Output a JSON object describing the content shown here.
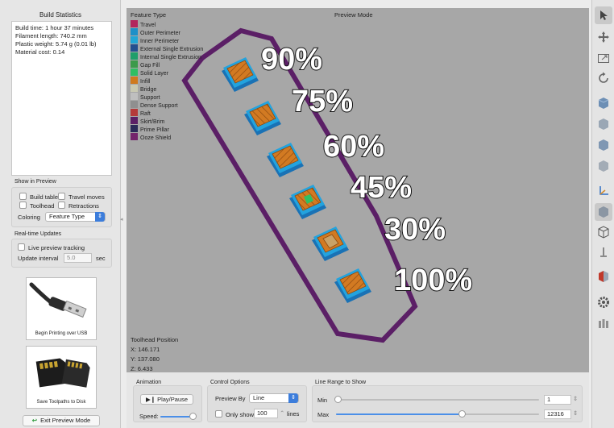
{
  "sidebar": {
    "stats_title": "Build Statistics",
    "stats": [
      "Build time: 1 hour 37 minutes",
      "Filament length: 740.2 mm",
      "Plastic weight: 5.74 g (0.01 lb)",
      "Material cost: 0.14"
    ],
    "show_in_preview": {
      "title": "Show in Preview",
      "build_table": "Build table",
      "travel_moves": "Travel moves",
      "toolhead": "Toolhead",
      "retractions": "Retractions",
      "coloring_label": "Coloring",
      "coloring_value": "Feature Type"
    },
    "realtime": {
      "title": "Real-time Updates",
      "live_preview": "Live preview tracking",
      "update_interval_label": "Update interval",
      "update_interval_value": "5.0",
      "update_interval_unit": "sec"
    },
    "usb_button": "Begin Printing over USB",
    "sd_button": "Save Toolpaths to Disk",
    "exit_button": "Exit Preview Mode"
  },
  "viewport": {
    "mode_title": "Preview Mode",
    "legend_title": "Feature Type",
    "legend": [
      {
        "label": "Travel",
        "color": "#b3265d"
      },
      {
        "label": "Outer Perimeter",
        "color": "#1e90c8"
      },
      {
        "label": "Inner Perimeter",
        "color": "#22a6d6"
      },
      {
        "label": "External Single Extrusion",
        "color": "#244f8f"
      },
      {
        "label": "Internal Single Extrusion",
        "color": "#1f9e6a"
      },
      {
        "label": "Gap Fill",
        "color": "#3b9a4a"
      },
      {
        "label": "Solid Layer",
        "color": "#2fbf63"
      },
      {
        "label": "Infill",
        "color": "#cf7a1e"
      },
      {
        "label": "Bridge",
        "color": "#c9c9b2"
      },
      {
        "label": "Support",
        "color": "#bfbfbf"
      },
      {
        "label": "Dense Support",
        "color": "#8f8f8f"
      },
      {
        "label": "Raft",
        "color": "#b53a3a"
      },
      {
        "label": "Skirt/Brim",
        "color": "#5b1f66"
      },
      {
        "label": "Prime Pillar",
        "color": "#2a2a58"
      },
      {
        "label": "Ooze Shield",
        "color": "#74246c"
      }
    ],
    "infill_labels": [
      "90%",
      "75%",
      "60%",
      "45%",
      "30%",
      "100%"
    ],
    "toolhead": {
      "title": "Toolhead Position",
      "x": "X: 146.171",
      "y": "Y: 137.080",
      "z": "Z: 6.433"
    }
  },
  "bottom": {
    "animation": {
      "title": "Animation",
      "play_label": "Play/Pause",
      "speed_label": "Speed:",
      "speed_level": 0.9
    },
    "control": {
      "title": "Control Options",
      "preview_by_label": "Preview By",
      "preview_by_value": "Line",
      "only_show_label": "Only show",
      "only_show_value": "100",
      "only_show_unit": "lines"
    },
    "range": {
      "title": "Line Range to Show",
      "min_label": "Min",
      "min_value": "1",
      "max_label": "Max",
      "max_value": "12316",
      "max_level": 0.62
    }
  },
  "toolbar": {
    "icons": [
      "cursor-icon",
      "move-icon",
      "scale-icon",
      "rotate-icon",
      "view-iso-icon",
      "view-front-icon",
      "view-top-icon",
      "view-side-icon",
      "axes-icon",
      "solid-view-icon",
      "wireframe-icon",
      "axis-z-icon",
      "section-icon",
      "settings-icon",
      "columns-icon"
    ]
  }
}
